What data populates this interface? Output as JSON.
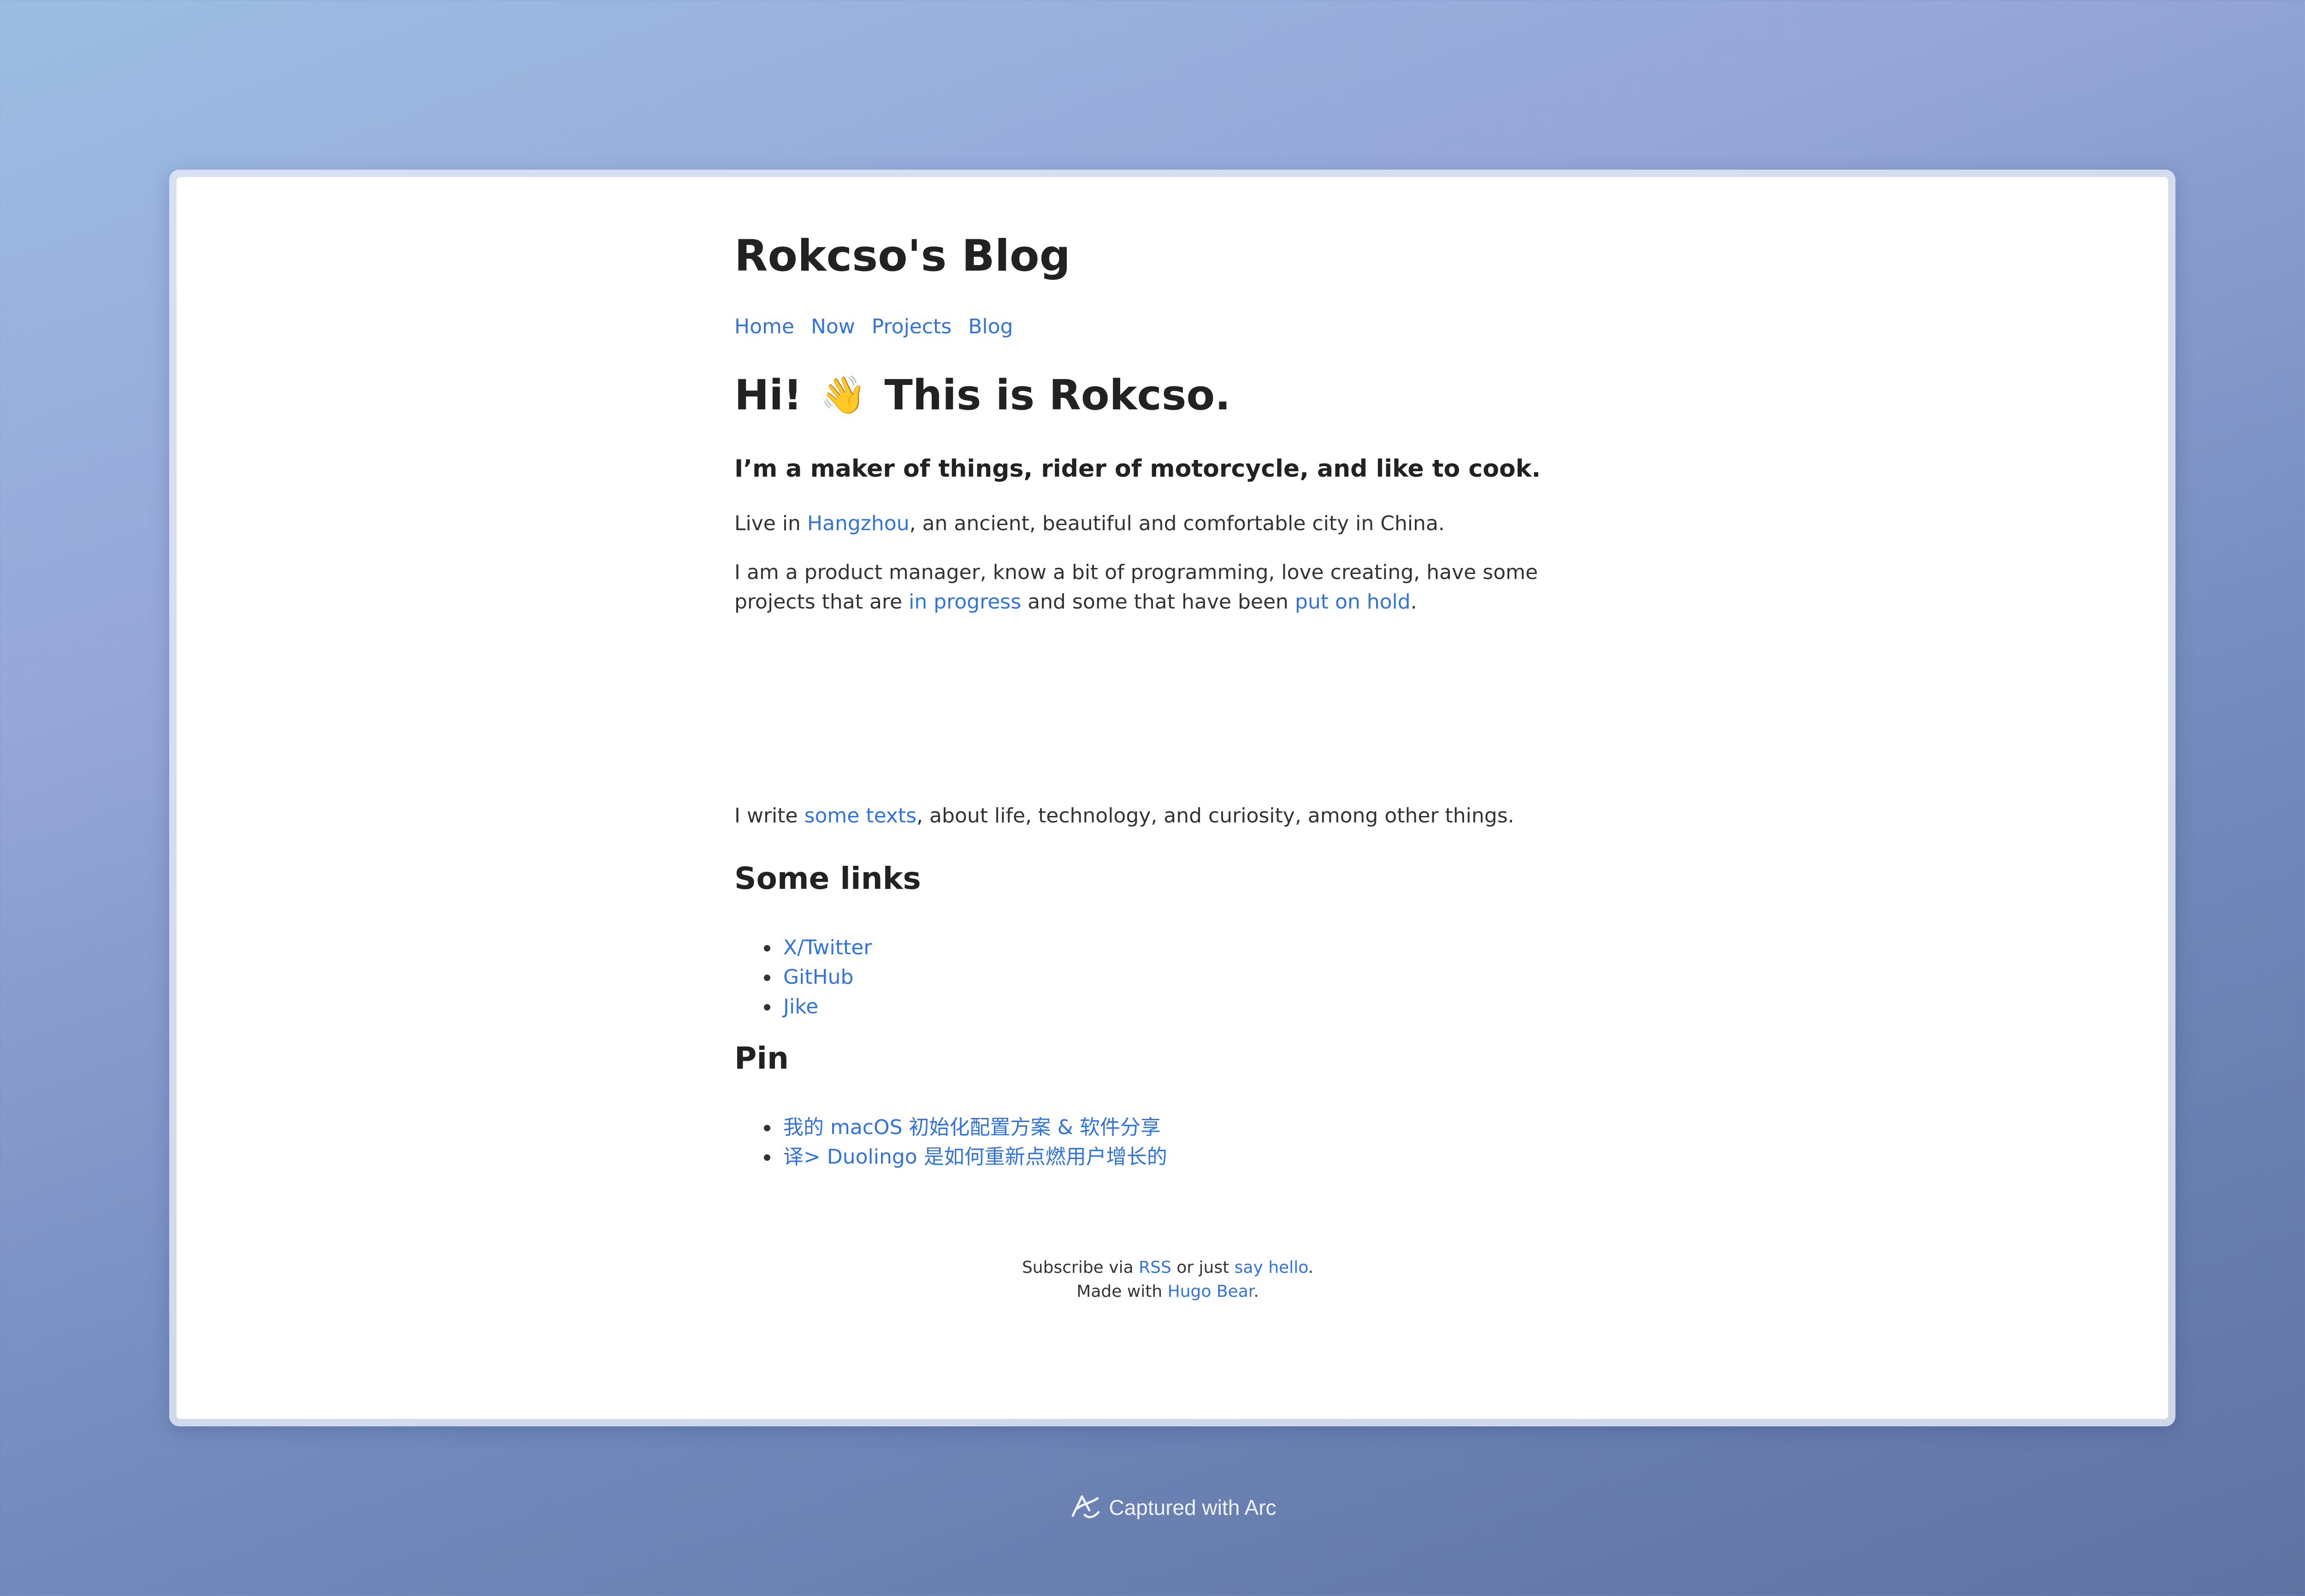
{
  "site": {
    "title": "Rokcso's Blog"
  },
  "nav": {
    "items": [
      {
        "label": "Home"
      },
      {
        "label": "Now"
      },
      {
        "label": "Projects"
      },
      {
        "label": "Blog"
      }
    ]
  },
  "hero": {
    "greeting": "Hi!",
    "wave_emoji": "👋",
    "title": "This is Rokcso."
  },
  "tagline": "I’m a maker of things, rider of motorcycle, and like to cook.",
  "about": {
    "p1_prefix": "Live in ",
    "p1_link": "Hangzhou",
    "p1_suffix": ", an ancient, beautiful and comfortable city in China.",
    "p2_prefix": "I am a product manager, know a bit of programming, love creating, have some projects that are ",
    "p2_link1": "in progress",
    "p2_middle": " and some that have been ",
    "p2_link2": "put on hold",
    "p2_suffix": ".",
    "p3_prefix": "I write ",
    "p3_link": "some texts",
    "p3_suffix": ", about life, technology, and curiosity, among other things."
  },
  "some_links": {
    "heading": "Some links",
    "items": [
      {
        "label": "X/Twitter"
      },
      {
        "label": "GitHub"
      },
      {
        "label": "Jike"
      }
    ]
  },
  "pin": {
    "heading": "Pin",
    "items": [
      {
        "label": "我的 macOS 初始化配置方案 & 软件分享"
      },
      {
        "label": "译> Duolingo 是如何重新点燃用户增长的"
      }
    ]
  },
  "footer": {
    "line1_prefix": "Subscribe via ",
    "rss_link": "RSS",
    "line1_middle": " or just ",
    "hello_link": "say hello",
    "line1_suffix": ".",
    "line2_prefix": "Made with ",
    "hugo_link": "Hugo Bear",
    "line2_suffix": "."
  },
  "capture": {
    "label": "Captured with Arc",
    "icon": "arc-logo-icon"
  },
  "colors": {
    "link": "#3273dc",
    "text": "#222222",
    "background_gradient_start": "#9cbde2",
    "background_gradient_end": "#5f73a3"
  }
}
